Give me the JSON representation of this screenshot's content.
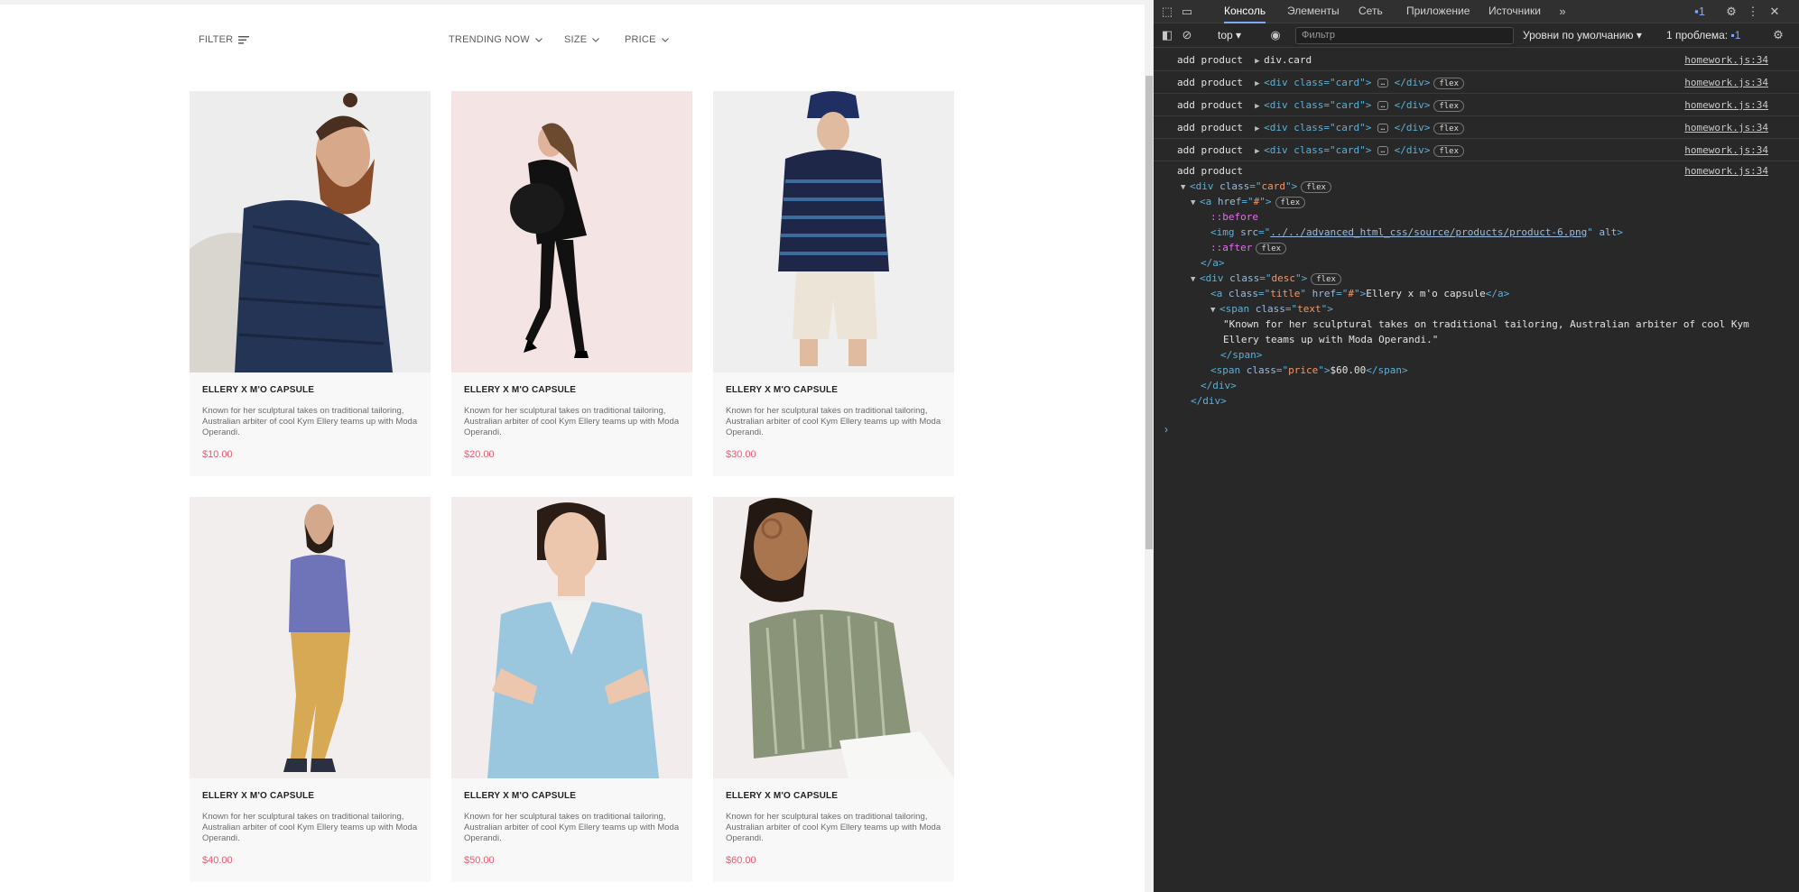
{
  "filterbar": {
    "filter": "FILTER",
    "trending": "TRENDING NOW",
    "size": "SIZE",
    "price": "PRICE"
  },
  "products": [
    {
      "title": "ELLERY X M'O CAPSULE",
      "text": "Known for her sculptural takes on traditional tailoring, Australian arbiter of cool Kym Ellery teams up with Moda Operandi.",
      "price": "$10.00"
    },
    {
      "title": "ELLERY X M'O CAPSULE",
      "text": "Known for her sculptural takes on traditional tailoring, Australian arbiter of cool Kym Ellery teams up with Moda Operandi.",
      "price": "$20.00"
    },
    {
      "title": "ELLERY X M'O CAPSULE",
      "text": "Known for her sculptural takes on traditional tailoring, Australian arbiter of cool Kym Ellery teams up with Moda Operandi.",
      "price": "$30.00"
    },
    {
      "title": "ELLERY X M'O CAPSULE",
      "text": "Known for her sculptural takes on traditional tailoring, Australian arbiter of cool Kym Ellery teams up with Moda Operandi.",
      "price": "$40.00"
    },
    {
      "title": "ELLERY X M'O CAPSULE",
      "text": "Known for her sculptural takes on traditional tailoring, Australian arbiter of cool Kym Ellery teams up with Moda Operandi.",
      "price": "$50.00"
    },
    {
      "title": "ELLERY X M'O CAPSULE",
      "text": "Known for her sculptural takes on traditional tailoring, Australian arbiter of cool Kym Ellery teams up with Moda Operandi.",
      "price": "$60.00"
    }
  ],
  "devtools": {
    "tabs": [
      "Консоль",
      "Элементы",
      "Сеть",
      "Приложение",
      "Источники"
    ],
    "issue_count_top": "1",
    "context": "top",
    "filter_placeholder": "Фильтр",
    "levels": "Уровни по умолчанию",
    "issues": "1 проблема:",
    "issues_count": "1",
    "console_rows": [
      {
        "msg": "add product",
        "obj": "div.card",
        "src": "homework.js:34"
      },
      {
        "msg": "add product",
        "obj": "<div class=\"card\">",
        "src": "homework.js:34"
      },
      {
        "msg": "add product",
        "obj": "<div class=\"card\">",
        "src": "homework.js:34"
      },
      {
        "msg": "add product",
        "obj": "<div class=\"card\">",
        "src": "homework.js:34"
      },
      {
        "msg": "add product",
        "obj": "<div class=\"card\">",
        "src": "homework.js:34"
      }
    ],
    "expanded": {
      "msg": "add product",
      "src": "homework.js:34",
      "img_src": "../../advanced_html_css/source/products/product-6.png",
      "title_text": "Ellery x m'o capsule",
      "text_line1": "\"Known for her sculptural takes on traditional tailoring, Australian arbiter of cool Kym",
      "text_line2": "Ellery teams up with Moda Operandi.\"",
      "price_text": "$60.00",
      "flex": "flex",
      "before": "::before",
      "after": "::after"
    }
  },
  "colors": {
    "price": "#ef5b70",
    "devtools_bg": "#282828",
    "accent": "#7cacf8"
  }
}
